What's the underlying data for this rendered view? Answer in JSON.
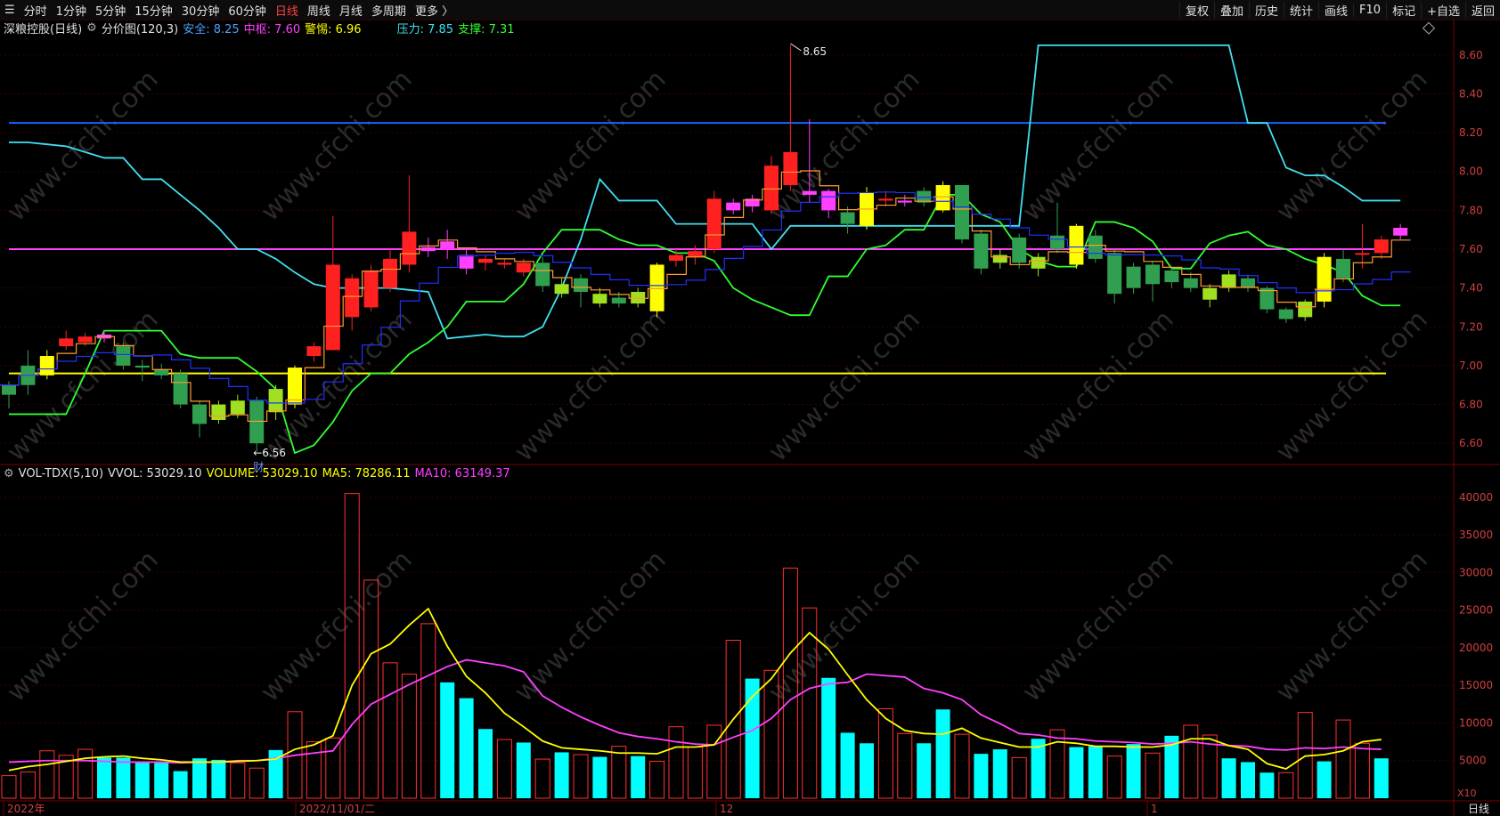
{
  "toolbar": {
    "menu_icon": "menu-icon",
    "periods": [
      "分时",
      "1分钟",
      "5分钟",
      "15分钟",
      "30分钟",
      "60分钟",
      "日线",
      "周线",
      "月线",
      "多周期",
      "更多 〉"
    ],
    "active_period": "日线",
    "right_buttons": [
      "复权",
      "叠加",
      "历史",
      "统计",
      "画线",
      "F10",
      "标记",
      "+自选",
      "返回"
    ]
  },
  "price_panel": {
    "stock_name": "深粮控股(日线)",
    "indicator_name": "分价图(120,3)",
    "safe_label": "安全: 8.25",
    "pivot_label": "中枢: 7.60",
    "alert_label": "警惕: 6.96",
    "pressure_label": "压力: 7.85",
    "support_label": "支撑: 7.31",
    "high_marker": "8.65",
    "low_marker": "←6.56",
    "cai_marker": "财",
    "y_ticks": [
      "8.60",
      "8.40",
      "8.20",
      "8.00",
      "7.80",
      "7.60",
      "7.40",
      "7.20",
      "7.00",
      "6.80",
      "6.60"
    ]
  },
  "volume_panel": {
    "indicator_name": "VOL-TDX(5,10)",
    "vvol_label": "VVOL: 53029.10",
    "volume_label": "VOLUME: 53029.10",
    "ma5_label": "MA5: 78286.11",
    "ma10_label": "MA10: 63149.37",
    "y_ticks": [
      "40000",
      "35000",
      "30000",
      "25000",
      "20000",
      "15000",
      "10000",
      "5000"
    ],
    "unit": "X10"
  },
  "x_axis": {
    "labels": [
      "2022年",
      "2022/11/01/二",
      "12",
      "1"
    ],
    "period_tab": "日线"
  },
  "watermark": "www.cfchi.com",
  "colors": {
    "up": "#ff2020",
    "down": "#30a050",
    "down_light": "#a0e020",
    "yellow": "#ffff00",
    "magenta": "#ff40ff",
    "blue": "#2060ff",
    "cyan": "#40e0f0",
    "green": "#30ff30"
  },
  "chart_data": {
    "type": "candlestick",
    "price_ylim": [
      6.5,
      8.7
    ],
    "volume_ylim": [
      0,
      42000
    ],
    "horizontal_lines": {
      "safe": 8.25,
      "pivot": 7.6,
      "alert": 6.96
    },
    "candles": [
      [
        6.85,
        6.9,
        6.78,
        6.92,
        "g"
      ],
      [
        6.9,
        7.0,
        6.85,
        7.08,
        "g"
      ],
      [
        6.95,
        7.05,
        6.93,
        7.08,
        "y"
      ],
      [
        7.1,
        7.14,
        7.08,
        7.18,
        "r"
      ],
      [
        7.12,
        7.15,
        7.1,
        7.17,
        "r"
      ],
      [
        7.14,
        7.16,
        7.12,
        7.18,
        "m"
      ],
      [
        7.1,
        7.0,
        6.98,
        7.12,
        "g"
      ],
      [
        7.0,
        6.99,
        6.92,
        7.03,
        "g"
      ],
      [
        6.98,
        6.95,
        6.93,
        7.01,
        "g"
      ],
      [
        6.96,
        6.8,
        6.78,
        6.98,
        "g"
      ],
      [
        6.8,
        6.7,
        6.63,
        6.82,
        "g"
      ],
      [
        6.8,
        6.72,
        6.7,
        6.82,
        "l"
      ],
      [
        6.75,
        6.82,
        6.73,
        6.85,
        "l"
      ],
      [
        6.82,
        6.6,
        6.56,
        6.84,
        "g"
      ],
      [
        6.76,
        6.88,
        6.72,
        6.9,
        "l"
      ],
      [
        6.8,
        6.99,
        6.78,
        7.0,
        "y"
      ],
      [
        7.05,
        7.1,
        7.02,
        7.12,
        "r"
      ],
      [
        7.08,
        7.52,
        7.08,
        7.77,
        "r"
      ],
      [
        7.25,
        7.45,
        7.18,
        7.47,
        "r"
      ],
      [
        7.3,
        7.49,
        7.28,
        7.52,
        "r"
      ],
      [
        7.4,
        7.55,
        7.38,
        7.6,
        "r"
      ],
      [
        7.52,
        7.69,
        7.48,
        7.98,
        "r"
      ],
      [
        7.59,
        7.61,
        7.56,
        7.66,
        "m"
      ],
      [
        7.6,
        7.64,
        7.55,
        7.7,
        "m"
      ],
      [
        7.5,
        7.57,
        7.47,
        7.6,
        "m"
      ],
      [
        7.53,
        7.55,
        7.49,
        7.57,
        "r"
      ],
      [
        7.52,
        7.53,
        7.5,
        7.55,
        "r"
      ],
      [
        7.48,
        7.53,
        7.46,
        7.55,
        "r"
      ],
      [
        7.53,
        7.41,
        7.38,
        7.56,
        "g"
      ],
      [
        7.37,
        7.42,
        7.35,
        7.45,
        "l"
      ],
      [
        7.45,
        7.38,
        7.3,
        7.47,
        "g"
      ],
      [
        7.32,
        7.37,
        7.3,
        7.4,
        "l"
      ],
      [
        7.32,
        7.35,
        7.3,
        7.38,
        "g"
      ],
      [
        7.38,
        7.32,
        7.3,
        7.4,
        "l"
      ],
      [
        7.28,
        7.52,
        7.25,
        7.53,
        "y"
      ],
      [
        7.54,
        7.57,
        7.51,
        7.6,
        "r"
      ],
      [
        7.56,
        7.59,
        7.52,
        7.62,
        "r"
      ],
      [
        7.6,
        7.86,
        7.58,
        7.9,
        "r"
      ],
      [
        7.8,
        7.84,
        7.78,
        7.86,
        "m"
      ],
      [
        7.82,
        7.86,
        7.79,
        7.88,
        "m"
      ],
      [
        7.8,
        8.03,
        7.78,
        8.08,
        "r"
      ],
      [
        7.93,
        8.1,
        7.9,
        8.65,
        "r"
      ],
      [
        7.9,
        7.88,
        7.84,
        8.27,
        "m"
      ],
      [
        7.9,
        7.8,
        7.76,
        7.91,
        "m"
      ],
      [
        7.79,
        7.73,
        7.68,
        7.82,
        "g"
      ],
      [
        7.72,
        7.89,
        7.7,
        7.92,
        "y"
      ],
      [
        7.85,
        7.86,
        7.82,
        7.9,
        "r"
      ],
      [
        7.85,
        7.84,
        7.82,
        7.88,
        "m"
      ],
      [
        7.9,
        7.84,
        7.82,
        7.92,
        "g"
      ],
      [
        7.8,
        7.93,
        7.79,
        7.95,
        "y"
      ],
      [
        7.93,
        7.65,
        7.63,
        7.93,
        "g"
      ],
      [
        7.68,
        7.5,
        7.47,
        7.7,
        "g"
      ],
      [
        7.57,
        7.53,
        7.5,
        7.6,
        "l"
      ],
      [
        7.66,
        7.53,
        7.5,
        7.68,
        "g"
      ],
      [
        7.5,
        7.56,
        7.46,
        7.58,
        "l"
      ],
      [
        7.6,
        7.67,
        7.58,
        7.84,
        "g"
      ],
      [
        7.72,
        7.52,
        7.5,
        7.73,
        "y"
      ],
      [
        7.55,
        7.67,
        7.53,
        7.7,
        "g"
      ],
      [
        7.37,
        7.58,
        7.32,
        7.6,
        "g"
      ],
      [
        7.4,
        7.51,
        7.37,
        7.53,
        "g"
      ],
      [
        7.42,
        7.52,
        7.33,
        7.54,
        "g"
      ],
      [
        7.43,
        7.49,
        7.4,
        7.51,
        "g"
      ],
      [
        7.45,
        7.4,
        7.38,
        7.48,
        "g"
      ],
      [
        7.4,
        7.34,
        7.3,
        7.42,
        "l"
      ],
      [
        7.4,
        7.47,
        7.38,
        7.49,
        "l"
      ],
      [
        7.45,
        7.4,
        7.38,
        7.47,
        "g"
      ],
      [
        7.4,
        7.29,
        7.27,
        7.41,
        "g"
      ],
      [
        7.24,
        7.29,
        7.22,
        7.3,
        "g"
      ],
      [
        7.25,
        7.33,
        7.23,
        7.34,
        "l"
      ],
      [
        7.33,
        7.56,
        7.3,
        7.58,
        "y"
      ],
      [
        7.55,
        7.45,
        7.43,
        7.6,
        "g"
      ],
      [
        7.58,
        7.58,
        7.5,
        7.73,
        "r"
      ],
      [
        7.58,
        7.65,
        7.55,
        7.67,
        "r"
      ],
      [
        7.67,
        7.71,
        7.65,
        7.73,
        "m"
      ]
    ],
    "pressure_line": [
      8.15,
      8.15,
      8.14,
      8.13,
      8.1,
      8.07,
      8.07,
      7.96,
      7.96,
      7.88,
      7.8,
      7.71,
      7.6,
      7.6,
      7.55,
      7.48,
      7.42,
      7.4,
      7.4,
      7.4,
      7.4,
      7.39,
      7.38,
      7.14,
      7.15,
      7.16,
      7.15,
      7.15,
      7.2,
      7.4,
      7.65,
      7.96,
      7.85,
      7.85,
      7.85,
      7.73,
      7.73,
      7.73,
      7.73,
      7.73,
      7.6,
      7.72,
      7.72,
      7.72,
      7.72,
      7.72,
      7.72,
      7.72,
      7.72,
      7.72,
      7.72,
      7.72,
      7.72,
      7.72,
      8.65,
      8.65,
      8.65,
      8.65,
      8.65,
      8.65,
      8.65,
      8.65,
      8.65,
      8.65,
      8.65,
      8.25,
      8.25,
      8.02,
      7.98,
      7.98,
      7.92,
      7.85,
      7.85,
      7.85
    ],
    "support_line": [
      6.75,
      6.75,
      6.75,
      6.75,
      6.96,
      7.18,
      7.18,
      7.18,
      7.18,
      7.06,
      7.04,
      7.04,
      7.04,
      6.97,
      6.88,
      6.55,
      6.59,
      6.71,
      6.87,
      6.96,
      6.96,
      7.06,
      7.12,
      7.2,
      7.33,
      7.33,
      7.33,
      7.42,
      7.58,
      7.7,
      7.7,
      7.7,
      7.65,
      7.62,
      7.62,
      7.58,
      7.58,
      7.54,
      7.4,
      7.34,
      7.3,
      7.26,
      7.26,
      7.46,
      7.46,
      7.6,
      7.62,
      7.7,
      7.7,
      7.88,
      7.88,
      7.78,
      7.74,
      7.6,
      7.54,
      7.51,
      7.51,
      7.74,
      7.74,
      7.71,
      7.64,
      7.5,
      7.5,
      7.63,
      7.67,
      7.69,
      7.62,
      7.6,
      7.55,
      7.52,
      7.48,
      7.36,
      7.31,
      7.31
    ],
    "volume": [
      3000,
      3500,
      6300,
      5700,
      6500,
      5400,
      5400,
      4800,
      4700,
      3600,
      5300,
      5100,
      4700,
      4000,
      6400,
      11500,
      7500,
      8000,
      40500,
      29000,
      18000,
      16500,
      23200,
      15400,
      13300,
      9200,
      7800,
      7400,
      5200,
      6100,
      5800,
      5500,
      6900,
      5600,
      4900,
      9500,
      6800,
      9700,
      21000,
      15900,
      17000,
      30600,
      25300,
      16000,
      8700,
      7300,
      11900,
      8600,
      7300,
      11800,
      8500,
      5900,
      6500,
      5400,
      7900,
      9100,
      6800,
      6900,
      5600,
      7200,
      6000,
      8300,
      9700,
      8400,
      5300,
      4800,
      3400,
      3400,
      11400,
      4900,
      10400,
      7300,
      5300
    ],
    "volume_color": [
      "r",
      "r",
      "r",
      "r",
      "r",
      "c",
      "c",
      "c",
      "c",
      "c",
      "c",
      "c",
      "r",
      "r",
      "c",
      "r",
      "r",
      "r",
      "r",
      "r",
      "r",
      "r",
      "r",
      "c",
      "c",
      "c",
      "r",
      "c",
      "r",
      "c",
      "r",
      "c",
      "r",
      "c",
      "r",
      "r",
      "r",
      "r",
      "r",
      "c",
      "r",
      "r",
      "r",
      "c",
      "c",
      "c",
      "r",
      "r",
      "c",
      "c",
      "r",
      "c",
      "c",
      "r",
      "c",
      "r",
      "c",
      "c",
      "r",
      "c",
      "r",
      "c",
      "r",
      "r",
      "c",
      "c",
      "c",
      "r",
      "r",
      "c",
      "r",
      "r",
      "c"
    ],
    "ma5": [
      3700,
      4200,
      4500,
      4900,
      5300,
      5500,
      5600,
      5300,
      5100,
      4800,
      4800,
      4800,
      4900,
      5000,
      5200,
      6500,
      7100,
      8300,
      15000,
      19200,
      20500,
      23000,
      25200,
      20200,
      16200,
      14000,
      11300,
      9500,
      7600,
      6700,
      6500,
      6300,
      6000,
      6000,
      5900,
      6800,
      6800,
      7100,
      10500,
      13500,
      15900,
      19300,
      22000,
      19800,
      16400,
      13100,
      10600,
      9000,
      8600,
      8500,
      9300,
      8000,
      7400,
      6800,
      6800,
      7500,
      7300,
      6900,
      6900,
      6800,
      6800,
      7100,
      7900,
      7900,
      7000,
      6500,
      4600,
      3900,
      5600,
      5800,
      6300,
      7500,
      7800
    ],
    "ma10": [
      4800,
      4900,
      5000,
      5000,
      5000,
      4900,
      4800,
      4800,
      4800,
      4700,
      4800,
      4800,
      5000,
      5000,
      5300,
      5700,
      6000,
      6300,
      9800,
      12500,
      13800,
      15100,
      16300,
      17500,
      18400,
      18000,
      17600,
      16800,
      13600,
      12100,
      10800,
      9700,
      8700,
      8200,
      7900,
      7500,
      7200,
      7100,
      8100,
      9000,
      10600,
      13100,
      14600,
      15200,
      15400,
      16500,
      16300,
      16100,
      14600,
      14000,
      13100,
      11100,
      9900,
      8600,
      8400,
      8000,
      7900,
      7600,
      7500,
      7400,
      7200,
      7300,
      7500,
      7200,
      7000,
      6900,
      6500,
      6400,
      6700,
      6600,
      6800,
      6600,
      6500
    ]
  }
}
